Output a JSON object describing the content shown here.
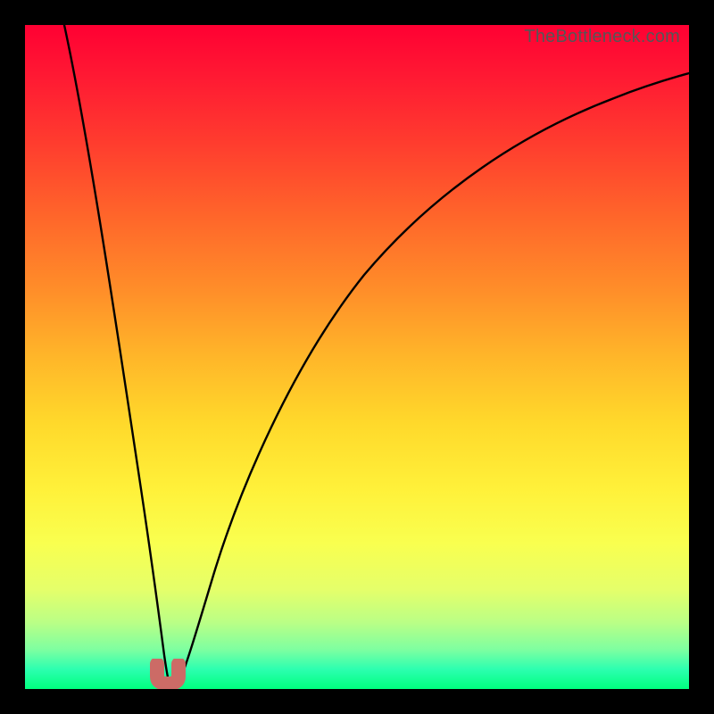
{
  "watermark": "TheBottleneck.com",
  "colors": {
    "marker": "#cc6b66",
    "curve": "#000000"
  },
  "chart_data": {
    "type": "line",
    "title": "",
    "xlabel": "",
    "ylabel": "",
    "xlim": [
      0,
      100
    ],
    "ylim": [
      0,
      100
    ],
    "grid": false,
    "legend": false,
    "series": [
      {
        "name": "bottleneck-curve",
        "x": [
          0,
          2,
          5,
          8,
          10,
          12,
          14,
          16,
          18,
          20,
          21,
          22,
          23,
          24,
          26,
          28,
          30,
          34,
          40,
          48,
          56,
          64,
          72,
          80,
          88,
          96,
          100
        ],
        "y": [
          100,
          90,
          76,
          62,
          52,
          42,
          32,
          22,
          13,
          5,
          2,
          0,
          0,
          2,
          8,
          14,
          20,
          30,
          42,
          54,
          63,
          70,
          76,
          80,
          83,
          86,
          87
        ]
      }
    ],
    "annotations": [
      {
        "name": "optimal-marker",
        "x": 22,
        "y": 0
      }
    ],
    "background_gradient": {
      "direction": "vertical",
      "stops": [
        {
          "pos": 0.0,
          "color": "#ff0033"
        },
        {
          "pos": 0.5,
          "color": "#ffb629"
        },
        {
          "pos": 0.78,
          "color": "#f9ff4f"
        },
        {
          "pos": 1.0,
          "color": "#00ff7f"
        }
      ]
    }
  }
}
